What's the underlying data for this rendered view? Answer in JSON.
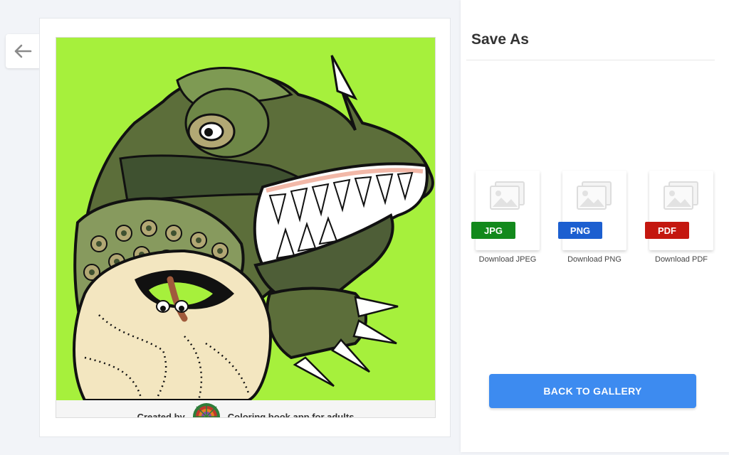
{
  "nav": {
    "back_icon": "arrow-left-icon"
  },
  "artwork": {
    "subject": "t-rex-and-hatching-egg",
    "background_color": "#a6f03c",
    "credit": {
      "created_by": "Created by",
      "app_name": "Coloring book app for adults",
      "logo_icon": "mandala-logo-icon"
    }
  },
  "save_panel": {
    "title": "Save As",
    "downloads": [
      {
        "badge": "JPG",
        "label": "Download JPEG",
        "color": "#12891c"
      },
      {
        "badge": "PNG",
        "label": "Download PNG",
        "color": "#1c5fd0"
      },
      {
        "badge": "PDF",
        "label": "Download PDF",
        "color": "#c4170f"
      }
    ],
    "back_to_gallery": {
      "label": "BACK TO GALLERY",
      "color": "#3d8bf0"
    }
  }
}
